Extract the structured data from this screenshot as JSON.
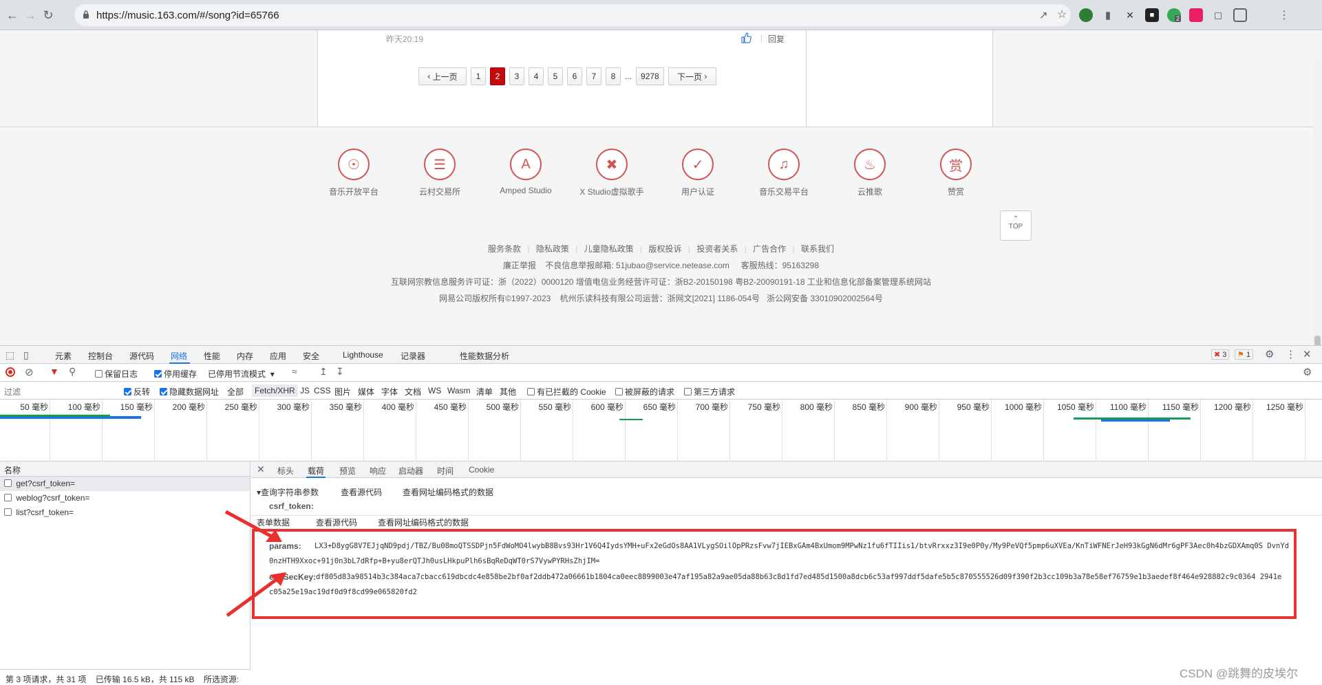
{
  "browser": {
    "url": "https://music.163.com/#/song?id=65766",
    "extensions_badge": "2"
  },
  "comment": {
    "time": "昨天20:19",
    "reply": "回复"
  },
  "pager": {
    "prev": "上一页",
    "pages": [
      "1",
      "2",
      "3",
      "4",
      "5",
      "6",
      "7",
      "8"
    ],
    "active": "2",
    "ellipsis": "...",
    "last": "9278",
    "next": "下一页"
  },
  "footer": {
    "services": [
      {
        "label": "音乐开放平台",
        "icon": "music-open-icon"
      },
      {
        "label": "云村交易所",
        "icon": "exchange-icon"
      },
      {
        "label": "Amped Studio",
        "icon": "amped-icon"
      },
      {
        "label": "X Studio虚拟歌手",
        "icon": "xstudio-icon"
      },
      {
        "label": "用户认证",
        "icon": "shield-icon"
      },
      {
        "label": "音乐交易平台",
        "icon": "trade-icon"
      },
      {
        "label": "云推歌",
        "icon": "flame-icon"
      },
      {
        "label": "赞赏",
        "icon": "reward-icon"
      }
    ],
    "top_label": "TOP",
    "links": [
      "服务条款",
      "隐私政策",
      "儿童隐私政策",
      "版权投诉",
      "投资者关系",
      "广告合作",
      "联系我们"
    ],
    "line2": "廉正举报    不良信息举报邮箱: 51jubao@service.netease.com     客服热线：95163298",
    "line3": "互联网宗教信息服务许可证：浙（2022）0000120 增值电信业务经营许可证：浙B2-20150198 粤B2-20090191-18  工业和信息化部备案管理系统网站",
    "line4": "网易公司版权所有©1997-2023    杭州乐读科技有限公司运营：浙网文[2021] 1186-054号   浙公网安备 33010902002564号"
  },
  "devtools": {
    "tabs": [
      "元素",
      "控制台",
      "源代码",
      "网络",
      "性能",
      "内存",
      "应用",
      "安全",
      "Lighthouse",
      "记录器",
      "性能数据分析"
    ],
    "selected_tab": "网络",
    "errors": "3",
    "warnings": "1",
    "toolbar": {
      "preserve_log": "保留日志",
      "disable_cache": "停用缓存",
      "throttle": "已停用节流模式"
    },
    "filter": {
      "placeholder": "过滤",
      "invert": "反转",
      "hide_data_urls": "隐藏数据网址",
      "types": [
        "全部",
        "Fetch/XHR",
        "JS",
        "CSS",
        "图片",
        "媒体",
        "字体",
        "文档",
        "WS",
        "Wasm",
        "清单",
        "其他"
      ],
      "blocked_cookies": "有已拦截的 Cookie",
      "blocked_requests": "被屏蔽的请求",
      "third_party": "第三方请求"
    },
    "timeline_ticks": [
      "50 毫秒",
      "100 毫秒",
      "150 毫秒",
      "200 毫秒",
      "250 毫秒",
      "300 毫秒",
      "350 毫秒",
      "400 毫秒",
      "450 毫秒",
      "500 毫秒",
      "550 毫秒",
      "600 毫秒",
      "650 毫秒",
      "700 毫秒",
      "750 毫秒",
      "800 毫秒",
      "850 毫秒",
      "900 毫秒",
      "950 毫秒",
      "1000 毫秒",
      "1050 毫秒",
      "1100 毫秒",
      "1150 毫秒",
      "1200 毫秒",
      "1250 毫秒"
    ],
    "name_header": "名称",
    "requests": [
      "get?csrf_token=",
      "weblog?csrf_token=",
      "list?csrf_token="
    ],
    "status": "第 3 项请求，共 31 项    已传输 16.5 kB，共 115 kB    所选资源:",
    "detail_tabs": [
      "标头",
      "载荷",
      "预览",
      "响应",
      "启动器",
      "时间",
      "Cookie"
    ],
    "detail_selected": "载荷",
    "query_section": "▾查询字符串参数",
    "view_source": "查看源代码",
    "view_url_encoded": "查看网址编码格式的数据",
    "csrf_key": "csrf_token:",
    "form_section": "表单数据",
    "params_key": "params:",
    "params_line1": "LX3+D8ygG8V7EJjqND9pdj/TBZ/Bu08moQTSSDPjn5FdWoMO4lwybB8Bvs93Hr1V6Q4IydsYMH+uFx2eGdOs8AA1VLygSOilOpPRzsFvw7jIEBxGAm4BxUmom9MPwNz1fu6fTIIis1/btvRrxxz3I9e0P0y/My9PeVQf5pmp6uXVEa/KnTiWFNErJeH93kGgN6dMr6gPF3Aec0h4bzGDXAmq0S DvnYd",
    "params_line2": "0nzHTH9Xxoc+91j0n3bL7dRfp+B+yu8erQTJh0usLHkpuPlh6sBqReDqWT0rS7VywPYRHsZhjIM=",
    "enc_key": "encSecKey:",
    "enc_line1": "df805d83a98514b3c384aca7cbacc619dbcdc4e858be2bf0af2ddb472a06661b1804ca0eec8899003e47af195a82a9ae05da88b63c8d1fd7ed485d1500a8dcb6c53af997ddf5dafe5b5c870555526d09f390f2b3cc109b3a78e58ef76759e1b3aedef8f464e928882c9c0364 2941e",
    "enc_line2": "c05a25e19ac19df0d9f8cd99e065820fd2"
  },
  "watermark": "CSDN @跳舞的皮埃尔",
  "colors": {
    "netease_red": "#c20c0c",
    "annotation_red": "#e8312f",
    "devtools_blue": "#1a73e8"
  }
}
